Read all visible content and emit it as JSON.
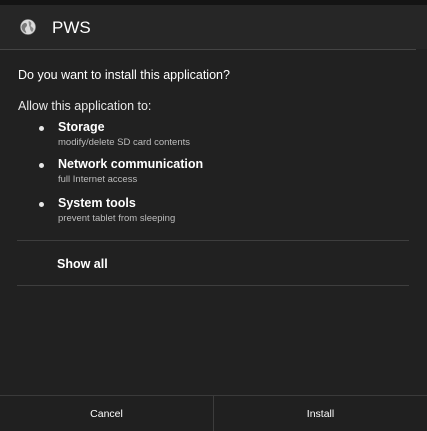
{
  "dialog": {
    "app_icon": "globe-icon",
    "app_name": "PWS",
    "question": "Do you want to install this application?",
    "allow_label": "Allow this application to:",
    "permissions": [
      {
        "title": "Storage",
        "description": "modify/delete SD card contents"
      },
      {
        "title": "Network communication",
        "description": "full Internet access"
      },
      {
        "title": "System tools",
        "description": "prevent tablet from sleeping"
      }
    ],
    "show_all": "Show all",
    "buttons": {
      "cancel": "Cancel",
      "install": "Install"
    }
  },
  "colors": {
    "background": "#212121",
    "text": "#ffffff",
    "secondary_text": "#bdbdbd",
    "divider": "#3e3e3e"
  }
}
